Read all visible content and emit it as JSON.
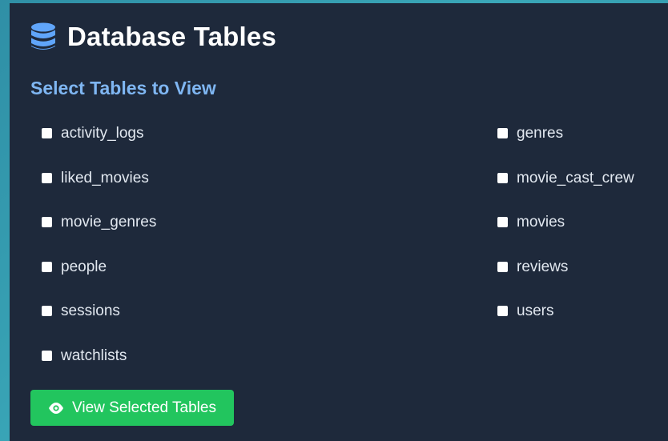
{
  "header": {
    "title": "Database Tables",
    "icon": "database-icon"
  },
  "subtitle": "Select Tables to View",
  "tables_left": [
    {
      "label": "activity_logs",
      "checked": false
    },
    {
      "label": "liked_movies",
      "checked": false
    },
    {
      "label": "movie_genres",
      "checked": false
    },
    {
      "label": "people",
      "checked": false
    },
    {
      "label": "sessions",
      "checked": false
    },
    {
      "label": "watchlists",
      "checked": false
    }
  ],
  "tables_right": [
    {
      "label": "genres",
      "checked": false
    },
    {
      "label": "movie_cast_crew",
      "checked": false
    },
    {
      "label": "movies",
      "checked": false
    },
    {
      "label": "reviews",
      "checked": false
    },
    {
      "label": "users",
      "checked": false
    }
  ],
  "view_button": {
    "label": "View Selected Tables",
    "icon": "eye-icon"
  },
  "colors": {
    "panel_bg": "#1e293b",
    "subtitle": "#7fb6f2",
    "accent_icon": "#60a5fa",
    "button_bg": "#22c55e"
  }
}
